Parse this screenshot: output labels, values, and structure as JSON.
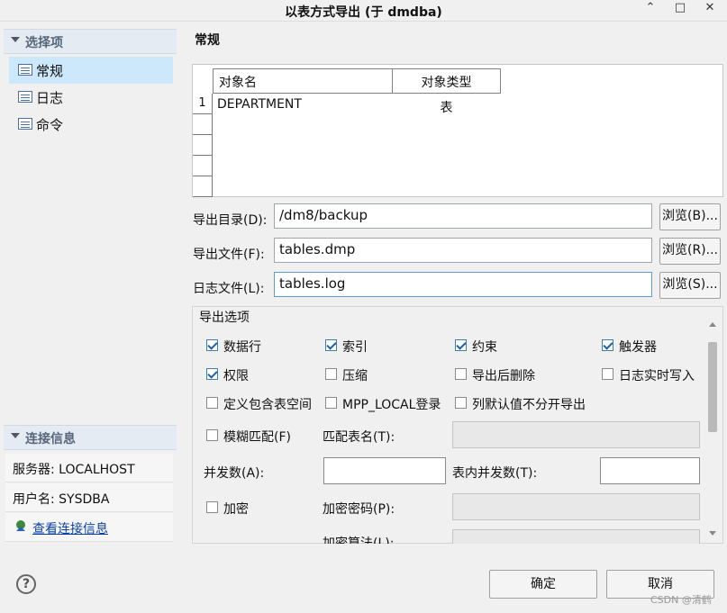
{
  "window": {
    "title": "以表方式导出 (于 dmdba)",
    "controls": [
      "⌃",
      "□",
      "✕"
    ]
  },
  "sidebar": {
    "header": "选择项",
    "items": [
      {
        "label": "常规",
        "selected": true
      },
      {
        "label": "日志",
        "selected": false
      },
      {
        "label": "命令",
        "selected": false
      }
    ]
  },
  "connection": {
    "header": "连接信息",
    "server": "服务器: LOCALHOST",
    "user": "用户名: SYSDBA",
    "view_link": "查看连接信息"
  },
  "main": {
    "section_title": "常规",
    "table": {
      "columns": [
        "对象名",
        "对象类型"
      ],
      "rows": [
        {
          "num": "1",
          "name": "DEPARTMENT",
          "type": "表"
        }
      ]
    },
    "fields": {
      "export_dir": {
        "label": "导出目录(D):",
        "value": "/dm8/backup",
        "button": "浏览(B)..."
      },
      "export_file": {
        "label": "导出文件(F):",
        "value": "tables.dmp",
        "button": "浏览(R)..."
      },
      "log_file": {
        "label": "日志文件(L):",
        "value": "tables.log",
        "button": "浏览(S)..."
      }
    },
    "options": {
      "title": "导出选项",
      "checkboxes": [
        {
          "label": "数据行",
          "checked": true
        },
        {
          "label": "索引",
          "checked": true
        },
        {
          "label": "约束",
          "checked": true
        },
        {
          "label": "触发器",
          "checked": true
        },
        {
          "label": "权限",
          "checked": true
        },
        {
          "label": "压缩",
          "checked": false
        },
        {
          "label": "导出后删除",
          "checked": false
        },
        {
          "label": "日志实时写入",
          "checked": false
        },
        {
          "label": "定义包含表空间",
          "checked": false
        },
        {
          "label": "MPP_LOCAL登录",
          "checked": false
        },
        {
          "label": "列默认值不分开导出",
          "checked": false
        }
      ],
      "fuzzy_match": {
        "label": "模糊匹配(F)",
        "checked": false
      },
      "match_table_label": "匹配表名(T):",
      "parallel_label": "并发数(A):",
      "table_parallel_label": "表内并发数(T):",
      "encrypt": {
        "label": "加密",
        "checked": false
      },
      "encrypt_password_label": "加密密码(P):",
      "encrypt_algo_label": "加密算法(L):"
    }
  },
  "footer": {
    "help": "?",
    "ok": "确定",
    "cancel": "取消",
    "watermark": "CSDN @清鹤"
  },
  "colors": {
    "selection": "#cde8fb",
    "sidebar_header": "#e4ebf3",
    "check": "#1f5fa8",
    "focus_border": "#5c9bd6"
  }
}
